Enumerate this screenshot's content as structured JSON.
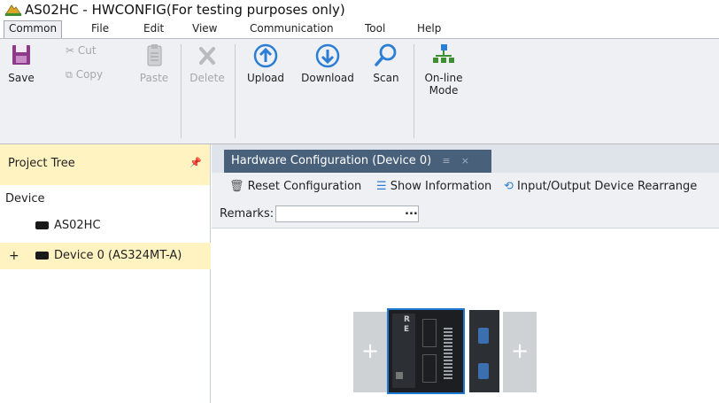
{
  "window": {
    "title": "AS02HC - HWCONFIG(For testing purposes only)"
  },
  "menu": {
    "items": [
      {
        "id": "common",
        "label": "Common",
        "active": true
      },
      {
        "id": "file",
        "label": "File"
      },
      {
        "id": "edit",
        "label": "Edit"
      },
      {
        "id": "view",
        "label": "View"
      },
      {
        "id": "communication",
        "label": "Communication"
      },
      {
        "id": "tool",
        "label": "Tool"
      },
      {
        "id": "help",
        "label": "Help"
      }
    ]
  },
  "ribbon": {
    "save": {
      "label": "Save",
      "icon": "save-icon"
    },
    "cut": {
      "label": "Cut",
      "icon": "cut-icon"
    },
    "copy": {
      "label": "Copy",
      "icon": "copy-icon"
    },
    "paste": {
      "label": "Paste",
      "icon": "paste-icon"
    },
    "delete": {
      "label": "Delete",
      "icon": "delete-icon"
    },
    "upload": {
      "label": "Upload",
      "icon": "upload-icon"
    },
    "download": {
      "label": "Download",
      "icon": "download-icon"
    },
    "scan": {
      "label": "Scan",
      "icon": "scan-icon"
    },
    "online_mode": {
      "label_line1": "On-line",
      "label_line2": "Mode",
      "icon": "online-mode-icon"
    }
  },
  "project_tree": {
    "title": "Project Tree",
    "pin_icon": "pin-icon",
    "root": "Device",
    "items": [
      {
        "label": "AS02HC",
        "icon": "folder-icon",
        "selected": false
      },
      {
        "label": "Device 0 (AS324MT-A)",
        "icon": "folder-icon",
        "selected": true,
        "expander": "+"
      }
    ]
  },
  "document": {
    "tab_title": "Hardware Configuration (Device 0)",
    "tab_pin": "≡",
    "tab_close": "×",
    "toolbar": {
      "reset": "Reset Configuration",
      "show_info": "Show Information",
      "rearrange": "Input/Output Device Rearrange"
    },
    "remarks_label": "Remarks:",
    "remarks_value": "",
    "remarks_button": "...",
    "canvas": {
      "add_left": "+",
      "add_right": "+",
      "cpu_led_1": "R",
      "cpu_led_2": "E"
    }
  },
  "colors": {
    "ribbon_bg": "#eef0f3",
    "accent_blue": "#2b7ed4",
    "tab_active": "#49607a",
    "selection_yellow": "#fff3c2",
    "selected_module_border": "#1f78d1"
  }
}
